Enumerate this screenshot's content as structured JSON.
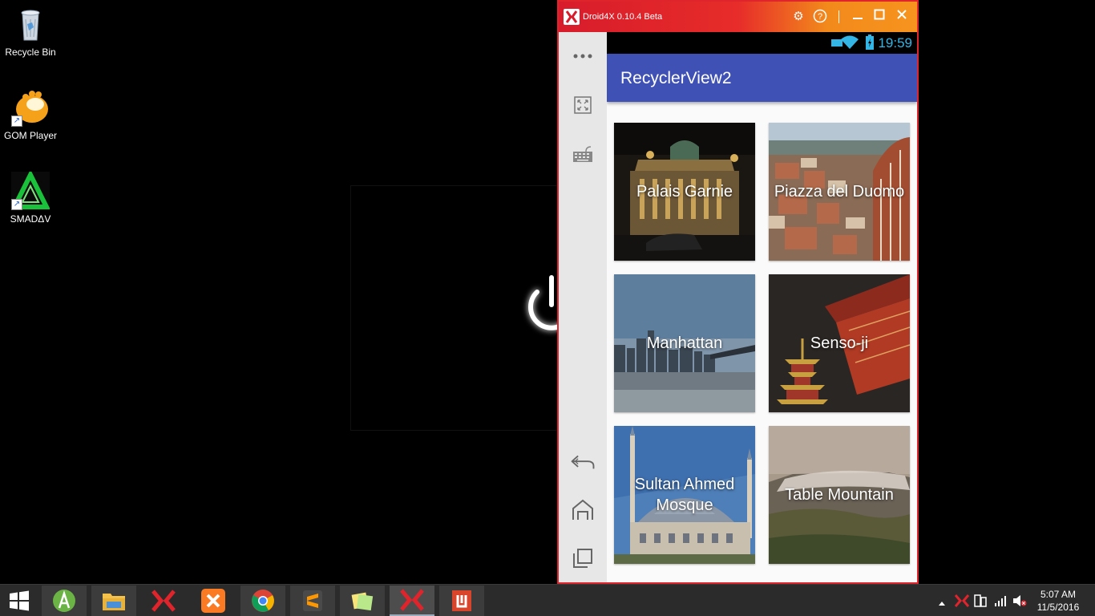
{
  "desktop": {
    "icons": [
      {
        "label": "Recycle Bin",
        "icon": "recycle-bin-icon"
      },
      {
        "label": "GOM Player",
        "icon": "gom-player-icon"
      },
      {
        "label": "SMADΔV",
        "icon": "smadav-icon"
      }
    ]
  },
  "emulator": {
    "title": "Droid4X 0.10.4 Beta",
    "titlebar_icons": [
      "settings-icon",
      "help-icon",
      "minimize-icon",
      "maximize-icon",
      "close-icon"
    ],
    "sidebar_icons": [
      "more-icon",
      "fullscreen-icon",
      "keyboard-icon",
      "back-icon",
      "home-icon",
      "recents-icon"
    ],
    "android": {
      "status_time": "19:59",
      "app_title": "RecyclerView2",
      "cards": [
        {
          "label": "Palais Garnie",
          "icon": "palais-garnier-photo"
        },
        {
          "label": "Piazza del Duomo",
          "icon": "piazza-del-duomo-photo"
        },
        {
          "label": "Manhattan",
          "icon": "manhattan-photo"
        },
        {
          "label": "Senso-ji",
          "icon": "senso-ji-photo"
        },
        {
          "label": "Sultan Ahmed Mosque",
          "icon": "sultan-ahmed-mosque-photo"
        },
        {
          "label": "Table Mountain",
          "icon": "table-mountain-photo"
        }
      ]
    }
  },
  "taskbar": {
    "apps": [
      "start-icon",
      "android-studio-icon",
      "file-explorer-icon",
      "droid4x-icon",
      "xampp-icon",
      "chrome-icon",
      "sublime-text-icon",
      "sticky-notes-icon",
      "droid4x-icon",
      "office-icon"
    ],
    "tray_time": "5:07 AM",
    "tray_date": "11/5/2016"
  }
}
